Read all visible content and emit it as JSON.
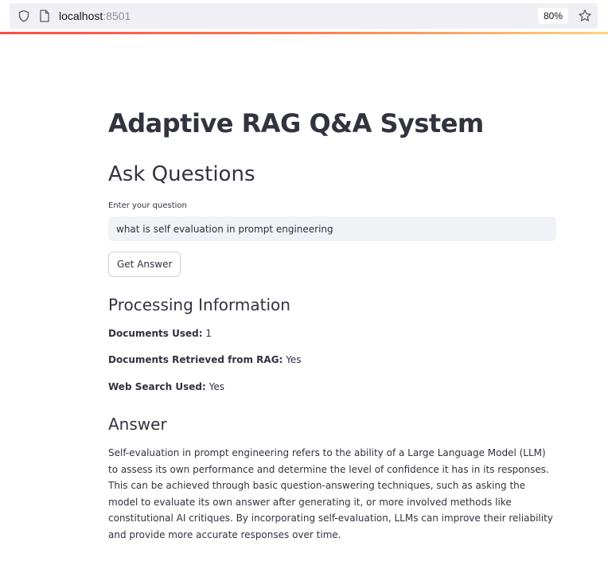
{
  "browser": {
    "url_host": "localhost",
    "url_port": ":8501",
    "zoom": "80%"
  },
  "app": {
    "title": "Adaptive RAG Q&A System",
    "section_title": "Ask Questions",
    "question_label": "Enter your question",
    "question_value": "what is self evaluation in prompt engineering",
    "submit_label": "Get Answer"
  },
  "processing": {
    "title": "Processing Information",
    "docs_used_label": "Documents Used:",
    "docs_used_value": "1",
    "docs_rag_label": "Documents Retrieved from RAG:",
    "docs_rag_value": "Yes",
    "web_search_label": "Web Search Used:",
    "web_search_value": "Yes"
  },
  "answer": {
    "title": "Answer",
    "text": "Self-evaluation in prompt engineering refers to the ability of a Large Language Model (LLM) to assess its own performance and determine the level of confidence it has in its responses. This can be achieved through basic question-answering techniques, such as asking the model to evaluate its own answer after generating it, or more involved methods like constitutional AI critiques. By incorporating self-evaluation, LLMs can improve their reliability and provide more accurate responses over time."
  },
  "colors": {
    "accent": "#ff4b4b",
    "text": "#31333f",
    "input_bg": "#f0f2f6"
  },
  "icons": {
    "shield": "shield-icon",
    "page": "page-icon",
    "star": "star-icon"
  }
}
